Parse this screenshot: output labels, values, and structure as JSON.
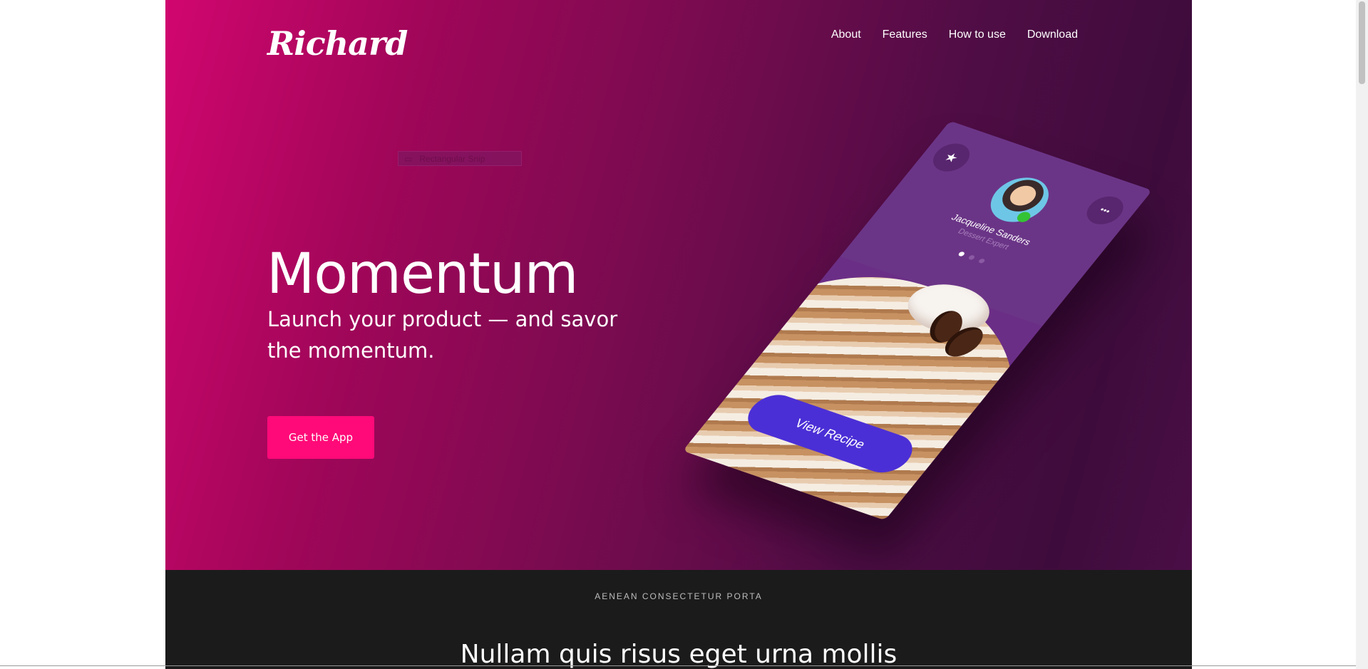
{
  "header": {
    "logo": "Richard",
    "nav": [
      "About",
      "Features",
      "How to use",
      "Download"
    ]
  },
  "snip_overlay": {
    "label": "Rectangular Snip"
  },
  "hero": {
    "title": "Momentum",
    "subtitle": "Launch your product — and savor the momentum.",
    "cta_label": "Get the App"
  },
  "phone": {
    "profile_name": "Jacqueline Sanders",
    "profile_role": "Dessert Expert",
    "button_label": "View Recipe",
    "star_glyph": "★",
    "more_glyph": "•••"
  },
  "section": {
    "eyebrow": "AENEAN CONSECTETUR PORTA",
    "heading": "Nullam quis risus eget urna mollis"
  },
  "colors": {
    "hero_start": "#d1066f",
    "hero_end": "#3e0c3c",
    "cta": "#ff0a78",
    "recipe_button": "#4b2fd6",
    "dark_section": "#1b1b1b"
  }
}
